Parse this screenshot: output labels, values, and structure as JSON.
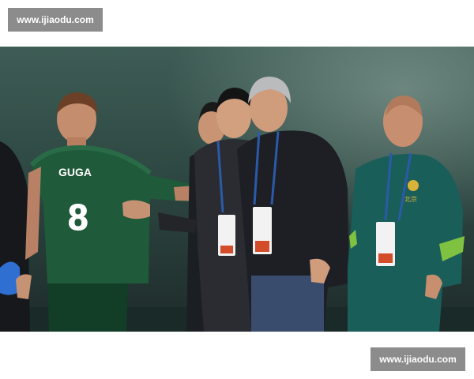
{
  "watermarks": {
    "top": "www.ijiaodu.com",
    "bottom": "www.ijiaodu.com"
  },
  "photo": {
    "player_name": "GUGA",
    "player_number": "8",
    "badge_text": "北京",
    "colors": {
      "jersey_green": "#1f5a3a",
      "jacket_teal": "#1a5e5a",
      "dark_coat": "#1d1f24",
      "lanyard_blue": "#2b5aa8",
      "background": "#2f4a44"
    }
  }
}
